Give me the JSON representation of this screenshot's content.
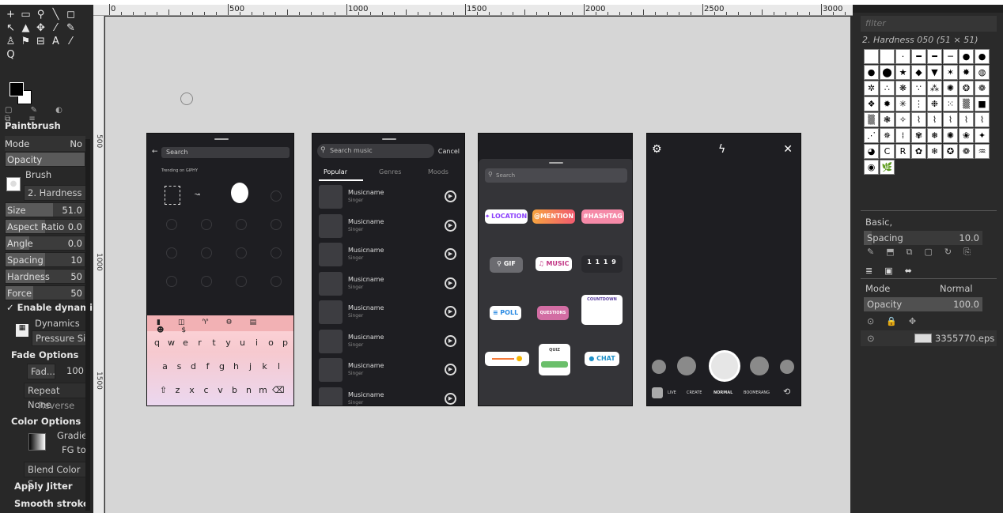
{
  "ruler": {
    "ticks": [
      "0",
      "500",
      "1000",
      "1500",
      "2000",
      "2500",
      "3000"
    ],
    "vlabels": [
      "500",
      "1000",
      "1500"
    ]
  },
  "toolbox": {
    "tool_icons": [
      "+",
      "▭",
      "⚲",
      "╲",
      "◻",
      "↖",
      "▲",
      "✥",
      "⁄",
      "✎",
      "♙",
      "⚑",
      "⊟",
      "A",
      "⁄",
      "Q"
    ],
    "title": "Paintbrush",
    "mode_label": "Mode",
    "mode_value": "No",
    "opacity_label": "Opacity",
    "brush_label": "Brush",
    "brush_value": "2. Hardness 0",
    "sliders": [
      {
        "label": "Size",
        "value": "51.0",
        "fill": 0.6
      },
      {
        "label": "Aspect Ratio",
        "value": "0.0",
        "fill": 0.5
      },
      {
        "label": "Angle",
        "value": "0.0",
        "fill": 0.3
      },
      {
        "label": "Spacing",
        "value": "10",
        "fill": 0.5
      },
      {
        "label": "Hardness",
        "value": "50",
        "fill": 0.5
      },
      {
        "label": "Force",
        "value": "50",
        "fill": 0.35
      }
    ],
    "enable_dynamics": "Enable dynami",
    "dynamics_label": "Dynamics",
    "dynamics_value": "Pressure Si",
    "fade_title": "Fade Options",
    "fade_value": "Fad...",
    "fade_num": "100",
    "repeat": "Repeat None",
    "reverse": "Reverse",
    "color_title": "Color Options",
    "gradient": "Gradie",
    "gradient_sub": "FG to",
    "blend": "Blend Color S",
    "jitter": "Apply Jitter",
    "smooth": "Smooth stroke"
  },
  "phone1": {
    "search": "Search",
    "trending": "Trending on GIPHY",
    "keys_row1": [
      "q",
      "w",
      "e",
      "r",
      "t",
      "y",
      "u",
      "i",
      "o",
      "p"
    ],
    "keys_row2": [
      "a",
      "s",
      "d",
      "f",
      "g",
      "h",
      "j",
      "k",
      "l"
    ],
    "keys_row3": [
      "⇧",
      "z",
      "x",
      "c",
      "v",
      "b",
      "n",
      "m",
      "⌫"
    ]
  },
  "phone2": {
    "search": "Search music",
    "cancel": "Cancel",
    "tabs": [
      "Popular",
      "Genres",
      "Moods"
    ],
    "tracks": [
      {
        "name": "Musicname",
        "singer": "Singer"
      },
      {
        "name": "Musicname",
        "singer": "Singer"
      },
      {
        "name": "Musicname",
        "singer": "Singer"
      },
      {
        "name": "Musicname",
        "singer": "Singer"
      },
      {
        "name": "Musicname",
        "singer": "Singer"
      },
      {
        "name": "Musicname",
        "singer": "Singer"
      },
      {
        "name": "Musicname",
        "singer": "Singer"
      },
      {
        "name": "Musicname",
        "singer": "Singer"
      }
    ]
  },
  "phone3": {
    "search": "Search",
    "stickers": {
      "location": "⌖ LOCATION",
      "mention": "@MENTION",
      "hashtag": "#HASHTAG",
      "gif": "⚲ GIF",
      "music": "♫ MUSIC",
      "time": "1 1 1 9",
      "poll": "≡ POLL",
      "questions": "QUESTIONS",
      "countdown": "COUNTDOWN",
      "quiz": "QUIZ",
      "chat": "● CHAT"
    }
  },
  "phone4": {
    "modes": [
      "LIVE",
      "CREATE",
      "NORMAL",
      "BOOMERANG"
    ]
  },
  "dock": {
    "filter": "filter",
    "brush": "2. Hardness 050 (51 × 51)",
    "preset": "Basic,",
    "spacing_label": "Spacing",
    "spacing_value": "10.0",
    "mode_label": "Mode",
    "mode_value": "Normal",
    "opacity_label": "Opacity",
    "opacity_value": "100.0",
    "layer": "3355770.eps"
  }
}
